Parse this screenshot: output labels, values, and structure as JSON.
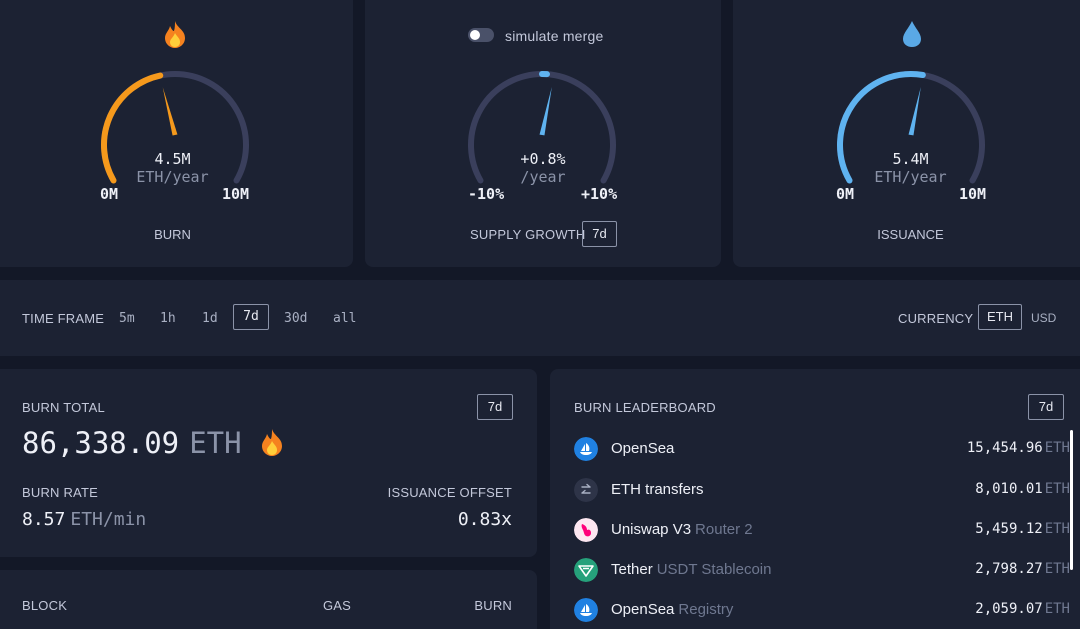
{
  "gauges": {
    "burn": {
      "value": "4.5M",
      "unit": "ETH/year",
      "min": "0M",
      "max": "10M",
      "title": "BURN",
      "fill_fraction": 0.45,
      "color": "#f5991c",
      "icon": "fire-icon"
    },
    "supply": {
      "toggle_label": "simulate merge",
      "value": "+0.8%",
      "unit": "/year",
      "min": "-10%",
      "max": "+10%",
      "title": "SUPPLY GROWTH",
      "timeframe": "7d",
      "fill_fraction": 0.54,
      "color": "#5fb3f0"
    },
    "issuance": {
      "value": "5.4M",
      "unit": "ETH/year",
      "min": "0M",
      "max": "10M",
      "title": "ISSUANCE",
      "fill_fraction": 0.54,
      "color": "#5fb3f0",
      "icon": "droplet-icon"
    }
  },
  "timeframe_bar": {
    "label": "TIME FRAME",
    "options": [
      "5m",
      "1h",
      "1d",
      "7d",
      "30d",
      "all"
    ],
    "selected": "7d",
    "currency_label": "CURRENCY",
    "currencies": [
      "ETH",
      "USD"
    ],
    "selected_currency": "ETH"
  },
  "burn_total": {
    "title": "BURN TOTAL",
    "timeframe": "7d",
    "value": "86,338.09",
    "unit": "ETH",
    "rate_label": "BURN RATE",
    "rate_value": "8.57",
    "rate_unit": "ETH/min",
    "offset_label": "ISSUANCE OFFSET",
    "offset_value": "0.83x"
  },
  "blocks": {
    "col_block": "BLOCK",
    "col_gas": "GAS",
    "col_burn": "BURN"
  },
  "leaderboard": {
    "title": "BURN LEADERBOARD",
    "timeframe": "7d",
    "rows": [
      {
        "name": "OpenSea",
        "sub": "",
        "value": "15,454.96",
        "unit": "ETH",
        "icon": "opensea-icon",
        "color": "#2081e2"
      },
      {
        "name": "ETH transfers",
        "sub": "",
        "value": "8,010.01",
        "unit": "ETH",
        "icon": "transfer-arrows-icon",
        "color": "#2e3448"
      },
      {
        "name": "Uniswap V3",
        "sub": "Router 2",
        "value": "5,459.12",
        "unit": "ETH",
        "icon": "uniswap-icon",
        "color": "#fde7f1"
      },
      {
        "name": "Tether",
        "sub": "USDT Stablecoin",
        "value": "2,798.27",
        "unit": "ETH",
        "icon": "tether-icon",
        "color": "#26a17b"
      },
      {
        "name": "OpenSea",
        "sub": "Registry",
        "value": "2,059.07",
        "unit": "ETH",
        "icon": "opensea-icon",
        "color": "#2081e2"
      }
    ]
  }
}
